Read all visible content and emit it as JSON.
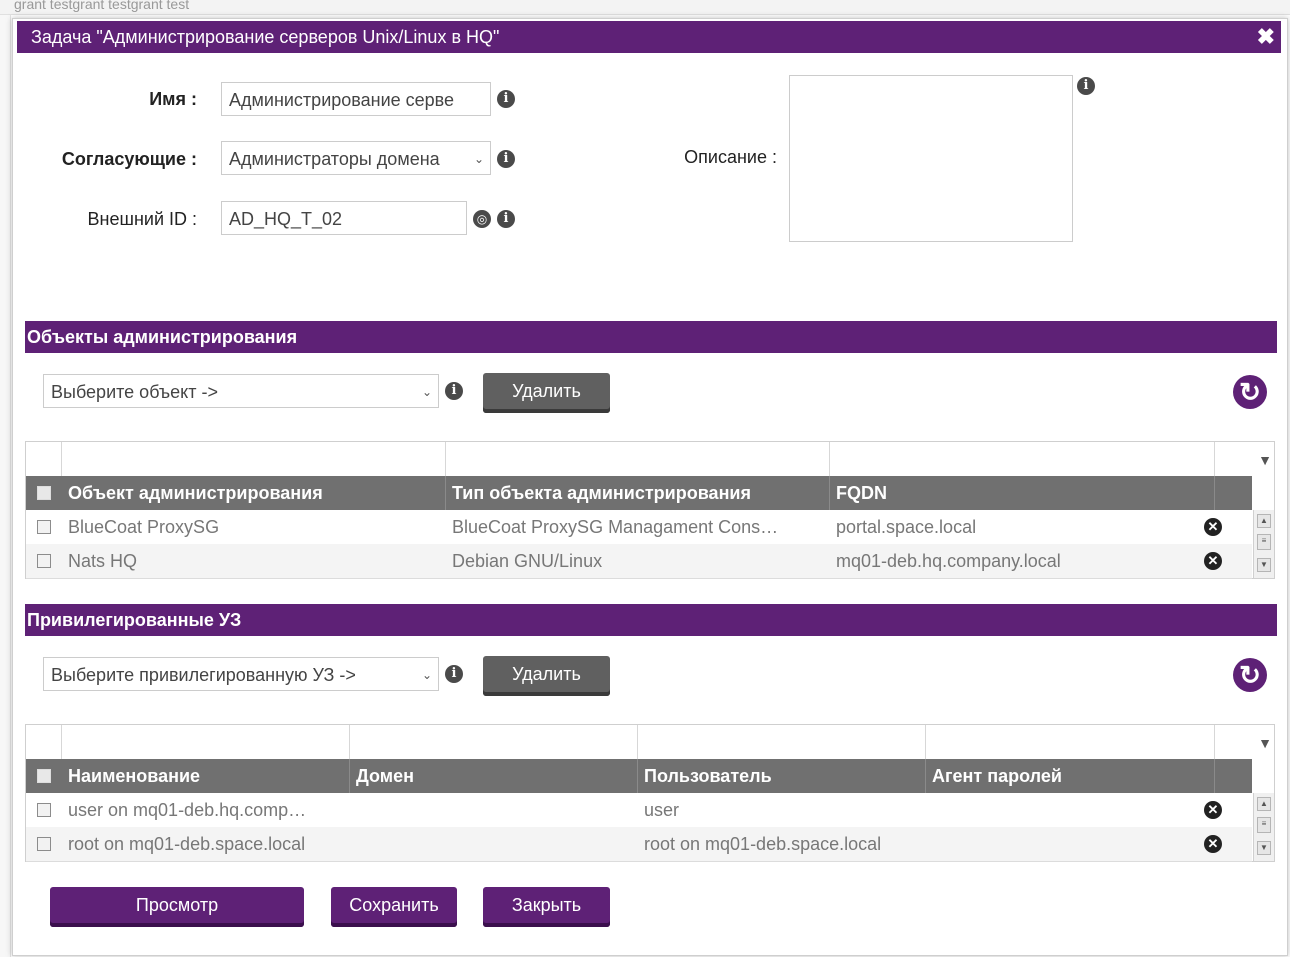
{
  "window": {
    "title": "Задача \"Администрирование серверов Unix/Linux в HQ\"",
    "close_glyph": "✖"
  },
  "background": {
    "text": "grant testgrant testgrant test"
  },
  "form": {
    "name_label": "Имя :",
    "name_value": "Администрирование серве",
    "approvers_label": "Согласующие :",
    "approvers_value": "Администраторы домена",
    "external_id_label": "Внешний ID :",
    "external_id_value": "AD_HQ_T_02",
    "description_label": "Описание :"
  },
  "objects_section": {
    "title": "Объекты администрирования",
    "select_placeholder": "Выберите объект ->",
    "delete_label": "Удалить",
    "columns": [
      "Объект администрирования",
      "Тип объекта администрирования",
      "FQDN"
    ],
    "rows": [
      {
        "name": "BlueCoat ProxySG",
        "type": "BlueCoat ProxySG Managament Cons…",
        "fqdn": "portal.space.local"
      },
      {
        "name": "Nats HQ",
        "type": "Debian GNU/Linux",
        "fqdn": "mq01-deb.hq.company.local"
      }
    ]
  },
  "accounts_section": {
    "title": "Привилегированные УЗ",
    "select_placeholder": "Выберите привилегированную УЗ ->",
    "delete_label": "Удалить",
    "columns": [
      "Наименование",
      "Домен",
      "Пользователь",
      "Агент паролей"
    ],
    "rows": [
      {
        "name": "user on mq01-deb.hq.comp…",
        "domain": "",
        "user": "user",
        "agent": ""
      },
      {
        "name": "root on mq01-deb.space.local",
        "domain": "",
        "user": "root on mq01-deb.space.local",
        "agent": ""
      }
    ]
  },
  "footer": {
    "view_label": "Просмотр",
    "save_label": "Сохранить",
    "close_label": "Закрыть"
  },
  "icons": {
    "info": "info-icon",
    "globe": "globe-icon",
    "refresh": "refresh-icon",
    "delete": "remove-icon",
    "filter": "filter-icon"
  },
  "colors": {
    "accent": "#5e2176",
    "header_grey": "#707070",
    "button_grey": "#606060"
  }
}
